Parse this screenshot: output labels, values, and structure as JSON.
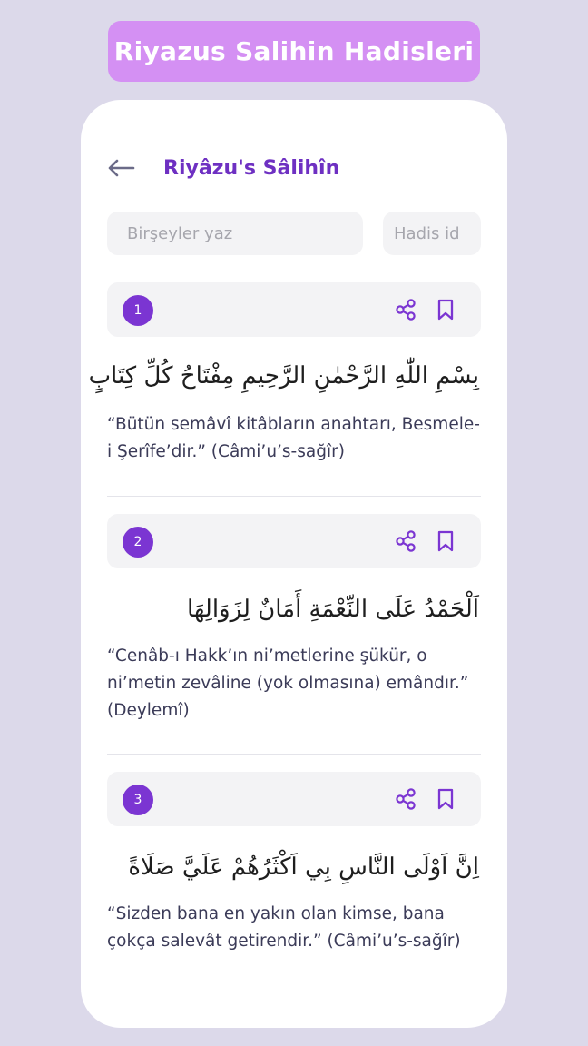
{
  "banner": {
    "title": "Riyazus Salihin Hadisleri"
  },
  "header": {
    "title": "Riyâzu's Sâlihîn"
  },
  "search": {
    "placeholder": "Birşeyler yaz",
    "id_placeholder": "Hadis id"
  },
  "colors": {
    "accent": "#7b35d2",
    "banner": "#d490f3",
    "background": "#dcd9ea"
  },
  "icons": {
    "back": "arrow-left-icon",
    "share": "share-icon",
    "bookmark": "bookmark-icon"
  },
  "hadiths": [
    {
      "number": "1",
      "arabic": "بِسْمِ اللّٰهِ الرَّحْمٰنِ الرَّحِيمِ مِفْتَاحُ كُلِّ كِتَابٍ",
      "meaning": "“Bütün semâvî kitâbların anahtarı, Besmele-i Şerîfe’dir.” (Câmi’u’s-sağîr)"
    },
    {
      "number": "2",
      "arabic": "اَلْحَمْدُ عَلَى النِّعْمَةِ أَمَانٌ لِزَوَالِهَا",
      "meaning": "“Cenâb-ı Hakk’ın ni’metlerine şükür, o ni’metin zevâline (yok olmasına) emândır.” (Deylemî)"
    },
    {
      "number": "3",
      "arabic": "اِنَّ اَوْلَى النَّاسِ بِي اَكْثَرُهُمْ عَلَيَّ صَلَاةً",
      "meaning": "“Sizden bana en yakın olan kimse, bana çokça salevât getirendir.” (Câmi’u’s-sağîr)"
    }
  ]
}
